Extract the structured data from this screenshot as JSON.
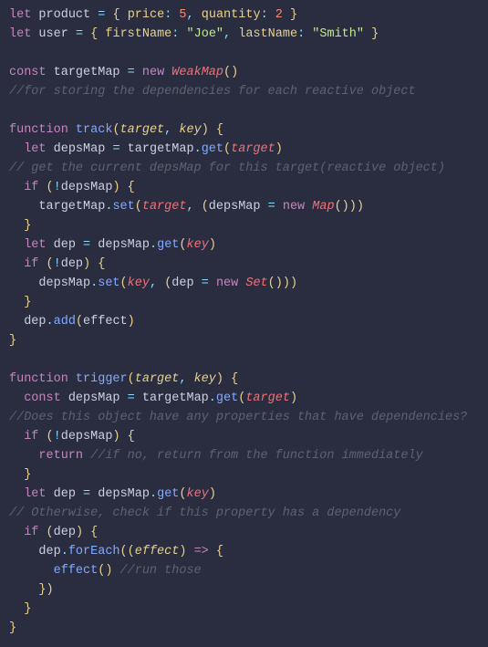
{
  "code": {
    "l01": {
      "kw1": "let",
      "id": "product",
      "p1": "price",
      "n1": "5",
      "p2": "quantity",
      "n2": "2"
    },
    "l02": {
      "kw1": "let",
      "id": "user",
      "p1": "firstName",
      "s1": "\"Joe\"",
      "p2": "lastName",
      "s2": "\"Smith\""
    },
    "l04": {
      "kw1": "const",
      "id": "targetMap",
      "kw2": "new",
      "cls": "WeakMap"
    },
    "l05": {
      "cmt": "//for storing the dependencies for each reactive object"
    },
    "l07": {
      "kw": "function",
      "fn": "track",
      "p1": "target",
      "p2": "key"
    },
    "l08": {
      "kw": "let",
      "id": "depsMap",
      "obj": "targetMap",
      "fn": "get",
      "arg": "target"
    },
    "l09": {
      "cmt": "// get the current depsMap for this target(reactive object)"
    },
    "l10": {
      "kw": "if",
      "id": "depsMap"
    },
    "l11": {
      "obj": "targetMap",
      "fn": "set",
      "arg1": "target",
      "id": "depsMap",
      "kw": "new",
      "cls": "Map"
    },
    "l12": {
      "brace": "}"
    },
    "l13": {
      "kw": "let",
      "id": "dep",
      "obj": "depsMap",
      "fn": "get",
      "arg": "key"
    },
    "l14": {
      "kw": "if",
      "id": "dep"
    },
    "l15": {
      "obj": "depsMap",
      "fn": "set",
      "arg1": "key",
      "id": "dep",
      "kw": "new",
      "cls": "Set"
    },
    "l16": {
      "brace": "}"
    },
    "l17": {
      "obj": "dep",
      "fn": "add",
      "arg": "effect"
    },
    "l18": {
      "brace": "}"
    },
    "l20": {
      "kw": "function",
      "fn": "trigger",
      "p1": "target",
      "p2": "key"
    },
    "l21": {
      "kw": "const",
      "id": "depsMap",
      "obj": "targetMap",
      "fn": "get",
      "arg": "target"
    },
    "l22": {
      "cmt": "//Does this object have any properties that have dependencies?"
    },
    "l23": {
      "kw": "if",
      "id": "depsMap"
    },
    "l24": {
      "kw": "return",
      "cmt": "//if no, return from the function immediately"
    },
    "l25": {
      "brace": "}"
    },
    "l26": {
      "kw": "let",
      "id": "dep",
      "obj": "depsMap",
      "fn": "get",
      "arg": "key"
    },
    "l27": {
      "cmt": "// Otherwise, check if this property has a dependency"
    },
    "l28": {
      "kw": "if",
      "id": "dep"
    },
    "l29": {
      "obj": "dep",
      "fn": "forEach",
      "arg": "effect"
    },
    "l30": {
      "fn": "effect",
      "cmt": "//run those"
    },
    "l31": {
      "close": "})"
    },
    "l32": {
      "brace": "}"
    },
    "l33": {
      "brace": "}"
    }
  }
}
